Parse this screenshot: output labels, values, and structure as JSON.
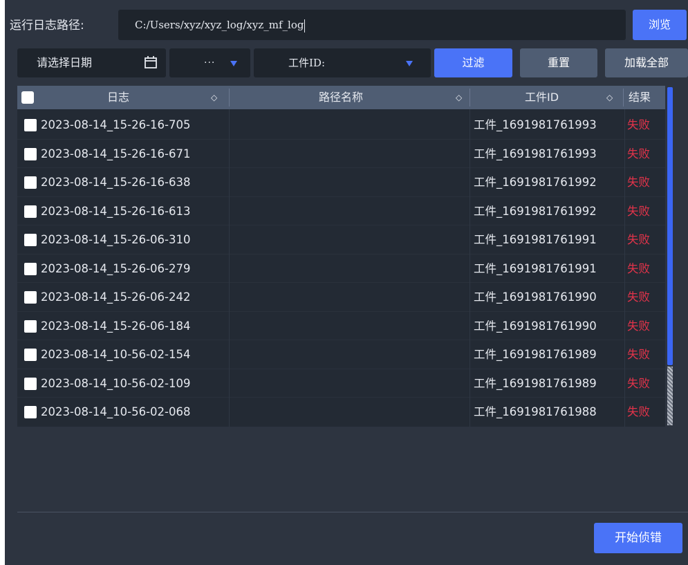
{
  "path_row": {
    "label": "运行日志路径:",
    "value": "C:/Users/xyz/xyz_log/xyz_mf_log",
    "browse_label": "浏览"
  },
  "filters": {
    "date_placeholder": "请选择日期",
    "dots_select_value": "···",
    "id_select_value": "工件ID:",
    "filter_label": "过滤",
    "reset_label": "重置",
    "load_all_label": "加载全部"
  },
  "table": {
    "columns": [
      "日志",
      "路径名称",
      "工件ID",
      "结果"
    ],
    "rows": [
      {
        "log": "2023-08-14_15-26-16-705",
        "path": "",
        "id": "工件_1691981761993",
        "result": "失败"
      },
      {
        "log": "2023-08-14_15-26-16-671",
        "path": "",
        "id": "工件_1691981761993",
        "result": "失败"
      },
      {
        "log": "2023-08-14_15-26-16-638",
        "path": "",
        "id": "工件_1691981761992",
        "result": "失败"
      },
      {
        "log": "2023-08-14_15-26-16-613",
        "path": "",
        "id": "工件_1691981761992",
        "result": "失败"
      },
      {
        "log": "2023-08-14_15-26-06-310",
        "path": "",
        "id": "工件_1691981761991",
        "result": "失败"
      },
      {
        "log": "2023-08-14_15-26-06-279",
        "path": "",
        "id": "工件_1691981761991",
        "result": "失败"
      },
      {
        "log": "2023-08-14_15-26-06-242",
        "path": "",
        "id": "工件_1691981761990",
        "result": "失败"
      },
      {
        "log": "2023-08-14_15-26-06-184",
        "path": "",
        "id": "工件_1691981761990",
        "result": "失败"
      },
      {
        "log": "2023-08-14_10-56-02-154",
        "path": "",
        "id": "工件_1691981761989",
        "result": "失败"
      },
      {
        "log": "2023-08-14_10-56-02-109",
        "path": "",
        "id": "工件_1691981761989",
        "result": "失败"
      },
      {
        "log": "2023-08-14_10-56-02-068",
        "path": "",
        "id": "工件_1691981761988",
        "result": "失败"
      }
    ]
  },
  "actions": {
    "start_label": "开始侦错"
  },
  "colors": {
    "accent": "#4a73f7",
    "background": "#2d3440",
    "field_bg": "#1e242c",
    "header_bg": "#4f5d73",
    "fail_text": "#e2334a"
  },
  "icons": {
    "date_picker": "calendar-icon",
    "sort": "sort-icon",
    "select_arrow": "triangle-down-icon"
  }
}
